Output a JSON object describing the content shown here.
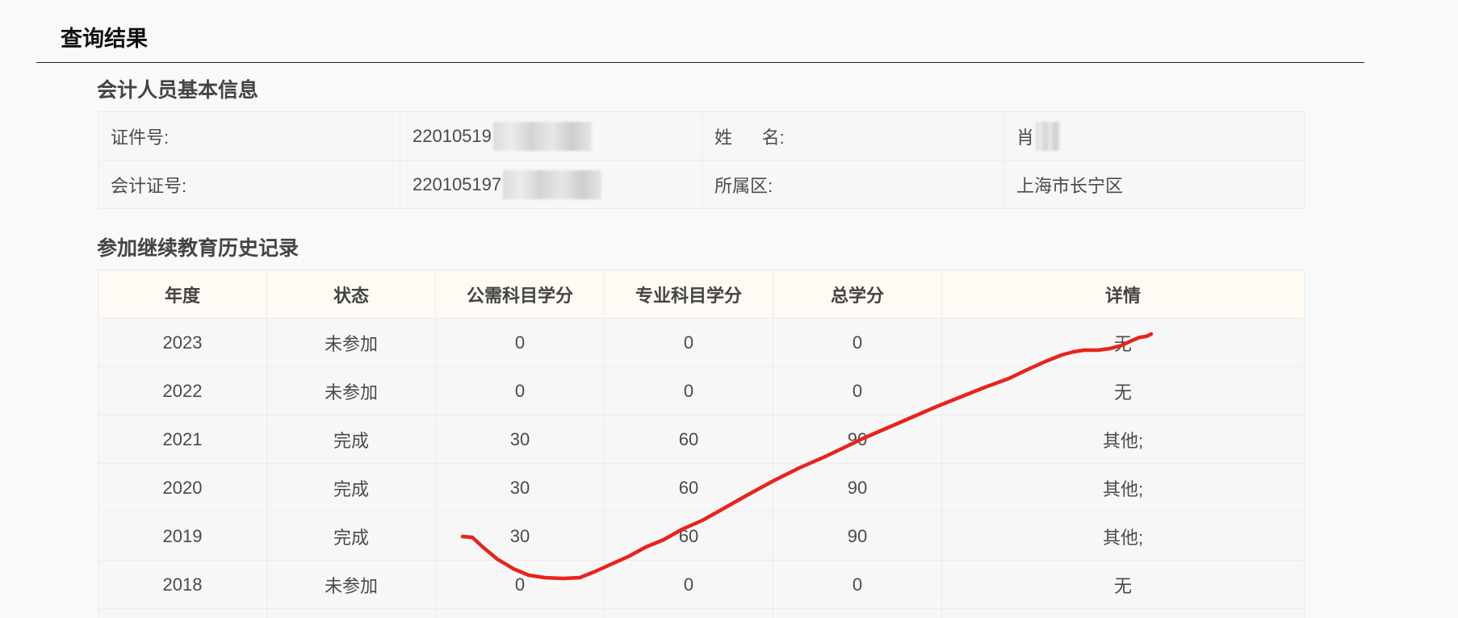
{
  "page": {
    "title": "查询结果"
  },
  "basic_info": {
    "heading": "会计人员基本信息",
    "id_label": "证件号:",
    "id_value": "22010519",
    "name_label": "姓      名:",
    "name_value": "肖",
    "cert_label": "会计证号:",
    "cert_value": "220105197",
    "district_label": "所属区:",
    "district_value": "上海市长宁区"
  },
  "history": {
    "heading": "参加继续教育历史记录",
    "columns": [
      "年度",
      "状态",
      "公需科目学分",
      "专业科目学分",
      "总学分",
      "详情"
    ],
    "rows": [
      [
        "2023",
        "未参加",
        "0",
        "0",
        "0",
        "无"
      ],
      [
        "2022",
        "未参加",
        "0",
        "0",
        "0",
        "无"
      ],
      [
        "2021",
        "完成",
        "30",
        "60",
        "90",
        "其他;"
      ],
      [
        "2020",
        "完成",
        "30",
        "60",
        "90",
        "其他;"
      ],
      [
        "2019",
        "完成",
        "30",
        "60",
        "90",
        "其他;"
      ],
      [
        "2018",
        "未参加",
        "0",
        "0",
        "0",
        "无"
      ]
    ]
  },
  "annotation": {
    "color": "#e8231c"
  }
}
